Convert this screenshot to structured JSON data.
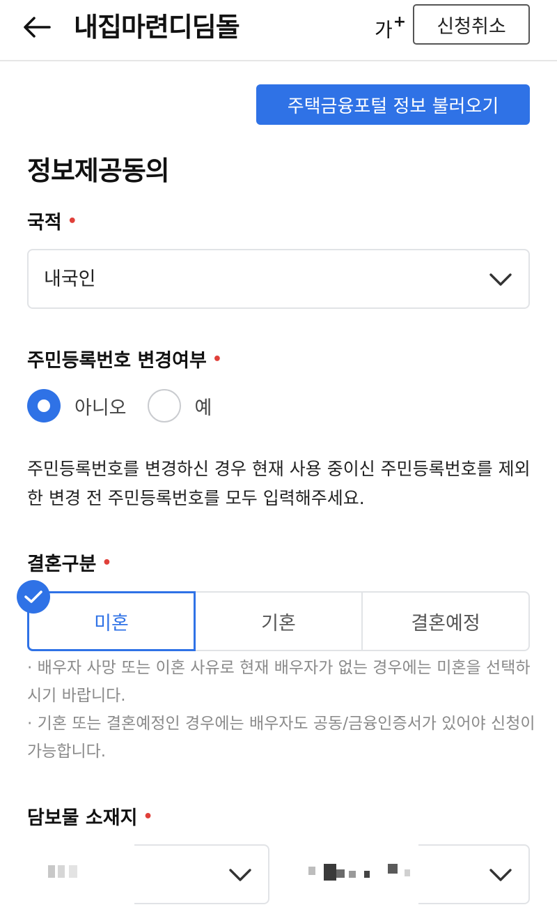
{
  "header": {
    "title": "내집마련디딤돌",
    "font_size_label": "가",
    "font_size_plus": "+",
    "cancel_label": "신청취소"
  },
  "import_button_label": "주택금융포털 정보 불러오기",
  "section_title": "정보제공동의",
  "nationality": {
    "label": "국적",
    "value": "내국인"
  },
  "resident_change": {
    "label": "주민등록번호 변경여부",
    "options": [
      "아니오",
      "예"
    ],
    "selected": "아니오",
    "info": "주민등록번호를 변경하신 경우 현재 사용 중이신 주민등록번호를 제외한 변경 전 주민등록번호를 모두 입력해주세요."
  },
  "marriage": {
    "label": "결혼구분",
    "options": [
      "미혼",
      "기혼",
      "결혼예정"
    ],
    "selected": "미혼",
    "notes": [
      "· 배우자 사망 또는 이혼 사유로 현재 배우자가 없는 경우에는 미혼을 선택하시기 바랍니다.",
      "· 기혼 또는 결혼예정인 경우에는 배우자도 공동/금융인증서가 있어야 신청이 가능합니다."
    ]
  },
  "collateral": {
    "label": "담보물 소재지"
  },
  "required_mark": "•",
  "colors": {
    "accent": "#2f72e6",
    "required": "#e0403a"
  },
  "icons": [
    "back-arrow-icon",
    "chevron-down-icon",
    "check-icon"
  ]
}
